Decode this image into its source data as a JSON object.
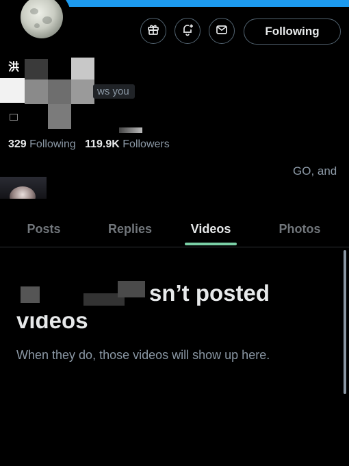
{
  "header": {
    "accent_color": "#1d9bf0",
    "icons": [
      "gift-icon",
      "notification-plus-icon",
      "mail-icon"
    ],
    "follow_button_label": "Following"
  },
  "profile": {
    "name_fragment": "洪",
    "follows_you_fragment": "ws you",
    "stats": {
      "following_count": "329",
      "following_label": "Following",
      "followers_count": "119.9K",
      "followers_label": "Followers"
    },
    "bio_fragment": "GO, and"
  },
  "tabs": [
    {
      "label": "Posts"
    },
    {
      "label": "Replies"
    },
    {
      "label": "Videos"
    },
    {
      "label": "Photos"
    }
  ],
  "active_tab": "Videos",
  "empty_state": {
    "title_fragment": "sn’t posted",
    "title_line2": "videos",
    "subtitle": "When they do, those videos will show up here."
  }
}
